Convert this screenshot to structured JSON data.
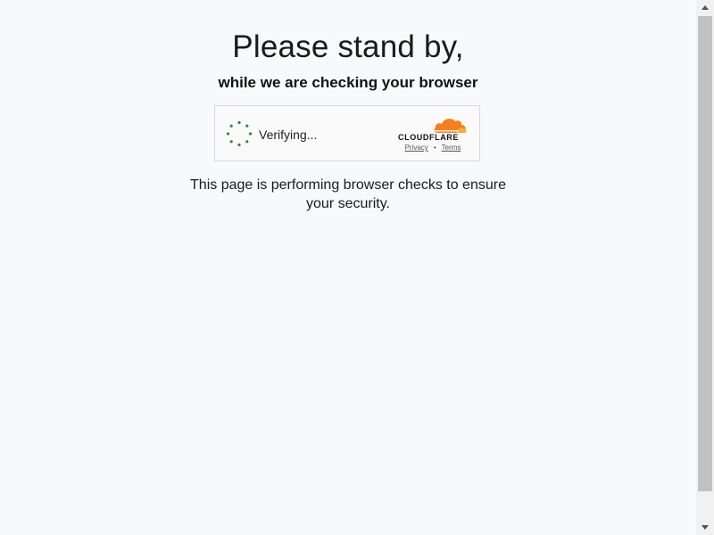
{
  "heading": {
    "title": "Please stand by,",
    "subtitle": "while we are checking your browser"
  },
  "challenge": {
    "status_label": "Verifying...",
    "brand_name": "CLOUDFLARE",
    "brand_color": "#f38020",
    "spinner_color": "#2e8b3a",
    "links": {
      "privacy": "Privacy",
      "separator": "•",
      "terms": "Terms"
    }
  },
  "message": {
    "text": "This page is performing browser checks to ensure your security."
  },
  "scrollbar": {
    "up_icon": "arrow-up-icon",
    "down_icon": "arrow-down-icon"
  }
}
